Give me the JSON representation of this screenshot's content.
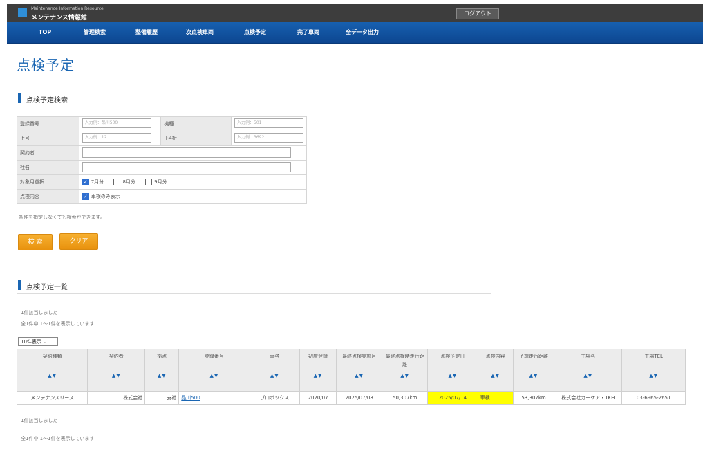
{
  "header": {
    "app_subtitle": "Maintenance Information Resource",
    "app_title": "メンテナンス情報館",
    "logout_label": "ログアウト"
  },
  "nav": {
    "items": [
      "TOP",
      "管理検索",
      "整備履歴",
      "次点検車両",
      "点検予定",
      "完了車両",
      "全データ出力"
    ]
  },
  "page": {
    "title": "点検予定"
  },
  "search": {
    "section_title": "点検予定検索",
    "fields": {
      "reg_no_label": "登録番号",
      "reg_no_placeholder": "入力例：品川500",
      "model_label": "機種",
      "model_placeholder": "入力例：501",
      "upper_label": "上号",
      "upper_placeholder": "入力例：12",
      "lower_label": "下4桁",
      "lower_placeholder": "入力例：3692",
      "contractor_label": "契約者",
      "company_label": "社名",
      "month_label": "対象月選択",
      "month_options": [
        {
          "label": "7月分",
          "checked": true
        },
        {
          "label": "8月分",
          "checked": false
        },
        {
          "label": "9月分",
          "checked": false
        }
      ],
      "content_label": "点検内容",
      "content_option": {
        "label": "車検のみ表示",
        "checked": true
      }
    },
    "note": "条件を指定しなくても検索ができます。",
    "search_label": "検 索",
    "clear_label": "クリア"
  },
  "results": {
    "section_title": "点検予定一覧",
    "found_text": "1件該当しました",
    "showing_text": "全1件中 1〜1件を表示しています",
    "page_size": "10件表示",
    "sort_symbol": "▲▼",
    "columns": [
      "契約種類",
      "契約者",
      "拠点",
      "登録番号",
      "車名",
      "初度登録",
      "最終点検実施月",
      "最終点検時走行距離",
      "点検予定日",
      "点検内容",
      "予想走行距離",
      "工場名",
      "工場TEL"
    ],
    "rows": [
      [
        "メンテナンスリース",
        "株式会社",
        "支社",
        "品川500",
        "プロボックス",
        "2020/07",
        "2025/07/08",
        "50,307km",
        "2025/07/14",
        "車検",
        "53,307km",
        "株式会社カーケア・TKH",
        "03-6965-2651"
      ]
    ],
    "found_text_bottom": "1件該当しました",
    "showing_text_bottom": "全1件中 1〜1件を表示しています"
  },
  "colors": {
    "nav_blue": "#1760b0",
    "title_blue": "#1a66b3",
    "button_orange": "#f0a020",
    "highlight": "#ffff00"
  }
}
